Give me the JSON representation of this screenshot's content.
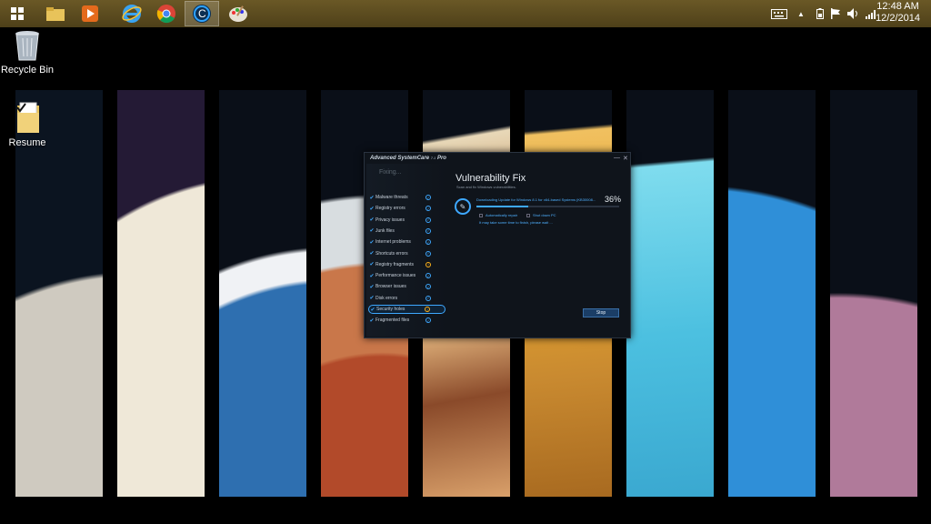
{
  "taskbar": {
    "apps": [
      {
        "name": "start",
        "icon": "start-icon"
      },
      {
        "name": "file-explorer",
        "icon": "folder-icon"
      },
      {
        "name": "media-player",
        "icon": "media-player-icon"
      },
      {
        "name": "internet-explorer",
        "icon": "internet-explorer-icon"
      },
      {
        "name": "chrome",
        "icon": "chrome-icon"
      },
      {
        "name": "advanced-systemcare",
        "icon": "advanced-systemcare-icon"
      },
      {
        "name": "paint",
        "icon": "paint-icon"
      }
    ],
    "clock": {
      "time": "12:48 AM",
      "date": "12/2/2014"
    }
  },
  "desktop": {
    "icons": [
      {
        "label": "Recycle Bin",
        "icon": "recycle-bin-icon"
      },
      {
        "label": "Resume",
        "icon": "resume-folder-icon"
      }
    ]
  },
  "app": {
    "title": "Advanced SystemCare",
    "version": "7.1",
    "edition": "Pro",
    "status": "Fixing...",
    "items": [
      {
        "label": "Malware threats",
        "state": "done"
      },
      {
        "label": "Registry errors",
        "state": "done"
      },
      {
        "label": "Privacy issues",
        "state": "done"
      },
      {
        "label": "Junk files",
        "state": "done"
      },
      {
        "label": "Internet problems",
        "state": "done"
      },
      {
        "label": "Shortcuts errors",
        "state": "done"
      },
      {
        "label": "Registry fragments",
        "state": "warning"
      },
      {
        "label": "Performance issues",
        "state": "done"
      },
      {
        "label": "Browser issues",
        "state": "done"
      },
      {
        "label": "Disk errors",
        "state": "done"
      },
      {
        "label": "Security holes",
        "state": "in-progress"
      },
      {
        "label": "Fragmented files",
        "state": "done"
      }
    ],
    "main": {
      "title": "Vulnerability Fix",
      "subtitle": "Scan and fix Windows vulnerabilities.",
      "download_text": "Downloading Update for Windows 8.1 for x64-based Systems (KB30008...",
      "progress_percent": "36%",
      "progress_fraction": 0.36,
      "options": [
        "Automatically repair",
        "Shut down PC"
      ],
      "hint": "It may take some time to finish, please wait ...",
      "stop_label": "Stop"
    }
  },
  "colors": {
    "accent": "#3ea8ff",
    "warning": "#ffb21a",
    "taskbar": "#5a4a1e"
  }
}
